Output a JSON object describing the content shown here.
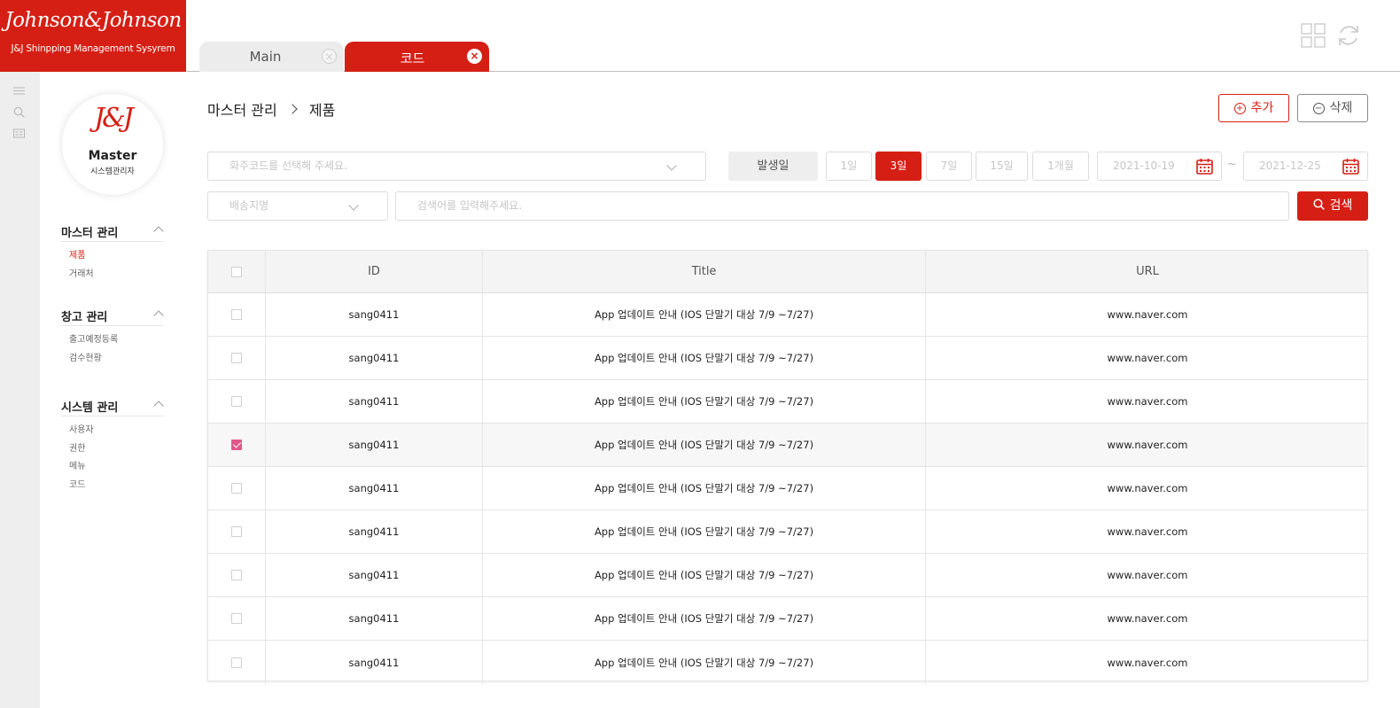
{
  "brand": {
    "logo_script": "Johnson&Johnson",
    "logo_subtitle": "J&J Shinpping Management Sysyrem",
    "primary_color": "#d51f14"
  },
  "rail": {
    "icons": [
      "menu-icon",
      "search-icon",
      "list-card-icon"
    ]
  },
  "profile": {
    "mark": "J&J",
    "name": "Master",
    "role": "시스템관리자"
  },
  "sidebar": {
    "groups": [
      {
        "title": "마스터 관리",
        "items": [
          "제품",
          "거래처"
        ],
        "active": "제품"
      },
      {
        "title": "창고 관리",
        "items": [
          "출고예정등록",
          "검수현황"
        ]
      },
      {
        "title": "시스템 관리",
        "items": [
          "사용자",
          "권한",
          "메뉴",
          "코드"
        ]
      }
    ]
  },
  "tabs": [
    {
      "label": "Main",
      "active": false
    },
    {
      "label": "코드",
      "active": true
    }
  ],
  "top_icons": [
    "grid-view-icon",
    "refresh-icon"
  ],
  "breadcrumb": {
    "parent": "마스터 관리",
    "current": "제품"
  },
  "actions": {
    "add_label": "추가",
    "delete_label": "삭제"
  },
  "filters": {
    "shipper_placeholder": "화주코드를 선택해 주세요.",
    "date_label": "발생일",
    "ranges": [
      "1일",
      "3일",
      "7일",
      "15일",
      "1개월"
    ],
    "active_range": "3일",
    "date_from": "2021-10-19",
    "date_separator": "~",
    "date_to": "2021-12-25",
    "destination_placeholder": "배송지명",
    "search_placeholder": "검색어를 입력해주세요.",
    "search_label": "검색"
  },
  "table": {
    "columns": [
      "ID",
      "Title",
      "URL"
    ],
    "rows": [
      {
        "checked": false,
        "id": "sang0411",
        "title": "App 업데이트 안내 (IOS 단말기 대상 7/9 ~7/27)",
        "url": "www.naver.com"
      },
      {
        "checked": false,
        "id": "sang0411",
        "title": "App 업데이트 안내 (IOS 단말기 대상 7/9 ~7/27)",
        "url": "www.naver.com"
      },
      {
        "checked": false,
        "id": "sang0411",
        "title": "App 업데이트 안내 (IOS 단말기 대상 7/9 ~7/27)",
        "url": "www.naver.com"
      },
      {
        "checked": true,
        "id": "sang0411",
        "title": "App 업데이트 안내 (IOS 단말기 대상 7/9 ~7/27)",
        "url": "www.naver.com"
      },
      {
        "checked": false,
        "id": "sang0411",
        "title": "App 업데이트 안내 (IOS 단말기 대상 7/9 ~7/27)",
        "url": "www.naver.com"
      },
      {
        "checked": false,
        "id": "sang0411",
        "title": "App 업데이트 안내 (IOS 단말기 대상 7/9 ~7/27)",
        "url": "www.naver.com"
      },
      {
        "checked": false,
        "id": "sang0411",
        "title": "App 업데이트 안내 (IOS 단말기 대상 7/9 ~7/27)",
        "url": "www.naver.com"
      },
      {
        "checked": false,
        "id": "sang0411",
        "title": "App 업데이트 안내 (IOS 단말기 대상 7/9 ~7/27)",
        "url": "www.naver.com"
      },
      {
        "checked": false,
        "id": "sang0411",
        "title": "App 업데이트 안내 (IOS 단말기 대상 7/9 ~7/27)",
        "url": "www.naver.com"
      }
    ],
    "checked_color": "#e0588a"
  }
}
